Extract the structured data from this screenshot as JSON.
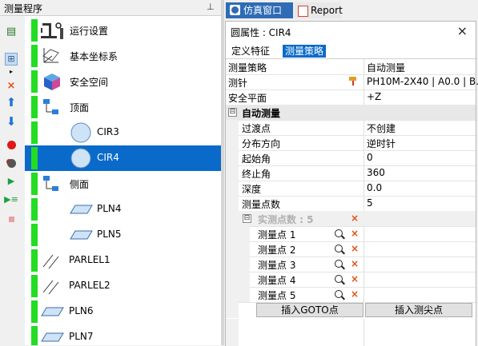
{
  "left_panel": {
    "title": "测量程序",
    "pin": "ᵖ",
    "tree_items": [
      {
        "label": "运行设置",
        "icon": "run-settings-icon"
      },
      {
        "label": "基本坐标系",
        "icon": "coordinate-system-icon"
      },
      {
        "label": "安全空间",
        "icon": "safety-space-cube-icon"
      },
      {
        "label": "顶面",
        "icon": "hierarchy-icon"
      },
      {
        "label": "CIR3",
        "icon": "circle-icon"
      },
      {
        "label": "CIR4",
        "icon": "circle-icon",
        "selected": true
      },
      {
        "label": "侧面",
        "icon": "hierarchy-icon"
      },
      {
        "label": "PLN4",
        "icon": "plane-icon"
      },
      {
        "label": "PLN5",
        "icon": "plane-icon"
      },
      {
        "label": "PARLEL1",
        "icon": "parallel-lines-icon"
      },
      {
        "label": "PARLEL2",
        "icon": "parallel-lines-icon"
      },
      {
        "label": "PLN6",
        "icon": "plane-icon"
      },
      {
        "label": "PLN7",
        "icon": "plane-icon"
      }
    ]
  },
  "tabs": {
    "simulation": "仿真窗口",
    "report": "Report"
  },
  "properties": {
    "title": "圆属性 : CIR4",
    "close": "×",
    "subtabs": {
      "definition": "定义特征",
      "measurement": "测量策略"
    },
    "rows": {
      "strategy": {
        "key": "测量策略",
        "value": "自动测量"
      },
      "probe": {
        "key": "测针",
        "value": "PH10M-2X40 | A0.0 | B..."
      },
      "safe_plane": {
        "key": "安全平面",
        "value": "+Z"
      }
    },
    "auto_section": {
      "title": "自动测量",
      "toggle": "⊟",
      "rows": {
        "transition": {
          "key": "过渡点",
          "value": "不创建"
        },
        "direction": {
          "key": "分布方向",
          "value": "逆时针"
        },
        "start_angle": {
          "key": "起始角",
          "value": "0"
        },
        "end_angle": {
          "key": "终止角",
          "value": "360"
        },
        "depth": {
          "key": "深度",
          "value": "0.0"
        },
        "points": {
          "key": "测量点数",
          "value": "5"
        }
      }
    },
    "actual_points": {
      "title": "实测点数 : 5",
      "toggle": "⊟",
      "items": [
        "测量点 1",
        "测量点 2",
        "测量点 3",
        "测量点 4",
        "测量点 5"
      ]
    },
    "buttons": {
      "insert_goto": "插入GOTO点",
      "insert_tip": "插入测尖点"
    }
  },
  "colors": {
    "selection": "#0a6ac9",
    "status_green": "#22dd22",
    "tab_active": "#2f6cb5",
    "delete_x": "#e05010"
  }
}
